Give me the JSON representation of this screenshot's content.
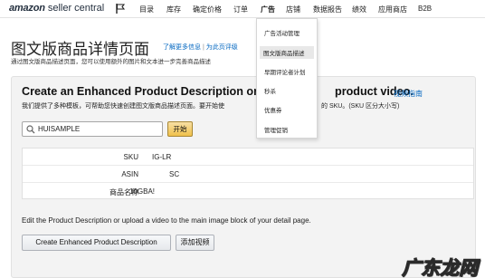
{
  "brand": {
    "amazon": "amazon",
    "suffix": " seller central"
  },
  "nav": {
    "items": [
      "目录",
      "库存",
      "确定价格",
      "订单",
      "广告",
      "店铺",
      "数据报告",
      "绩效",
      "应用商店",
      "B2B"
    ],
    "active": "广告"
  },
  "ad_menu": {
    "items": [
      "广告活动管理",
      "图文版商品描述",
      "早期评论者计划",
      "秒杀",
      "优惠券",
      "管理促销"
    ],
    "highlighted": "图文版商品描述"
  },
  "header": {
    "title": "图文版商品详情页面",
    "learn_more": "了解更多信息",
    "sep": " | ",
    "feedback": "为此页评级",
    "subtitle": "通过图文版商品描述页面，您可以使用额外的图片和文本进一步完善商品描述"
  },
  "panel": {
    "title_left": "Create an Enhanced Product Description or up",
    "title_right": "product video.",
    "video_link": "视频指南",
    "desc_left": "我们提供了多种模板，可帮助您快速创建图文版商品描述页面。要开始使",
    "desc_right": "的 SKU。(SKU 区分大小写)"
  },
  "search": {
    "value": "HUISAMPLE",
    "button": "开始"
  },
  "details": [
    {
      "label": "SKU",
      "value": "IG-LR"
    },
    {
      "label": "ASIN",
      "value": "SC"
    },
    {
      "label": "商品名称",
      "value": "10GBA!"
    }
  ],
  "edit": {
    "text": "Edit the Product Description or upload a video to the main image block of your detail page.",
    "create_button": "Create Enhanced Product Description",
    "video_button": "添加视频"
  },
  "watermark": "广东龙网"
}
